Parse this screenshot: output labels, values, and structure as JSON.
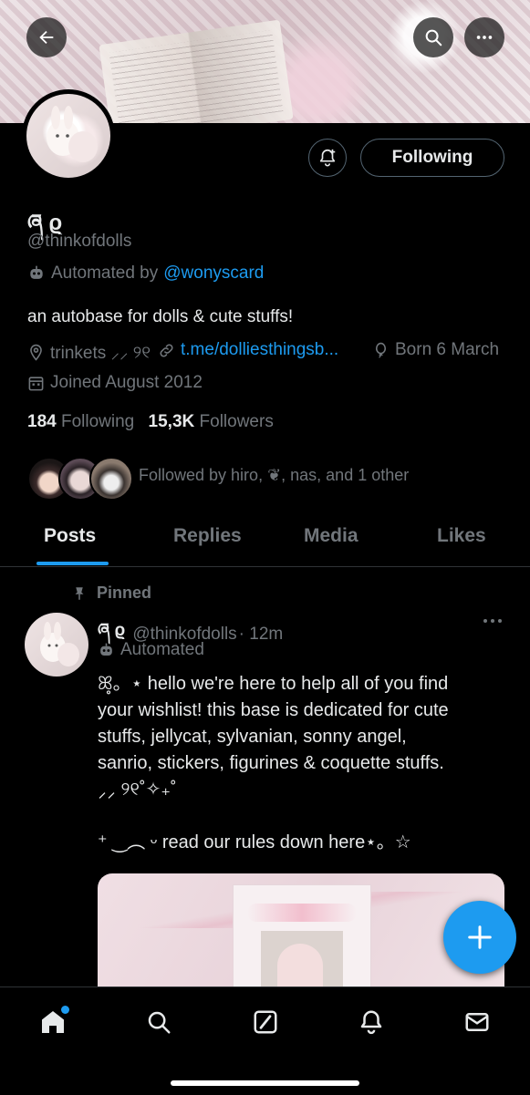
{
  "header": {
    "back_icon": "arrow-left-icon",
    "search_icon": "search-icon",
    "more_icon": "more-horizontal-icon"
  },
  "profile": {
    "display_name": "ཞ ϱ",
    "handle": "@thinkofdolls",
    "automated_prefix": "Automated by",
    "automated_by": "@wonyscard",
    "bio": "an autobase for dolls & cute stuffs!",
    "location": "trinkets ⸝⸝ ୨୧",
    "link": "t.me/dolliesthingsb...",
    "birthday": "Born 6 March",
    "joined": "Joined August 2012",
    "following_count": "184",
    "following_label": "Following",
    "followers_count": "15,3K",
    "followers_label": "Followers",
    "followed_by": "Followed by hiro, ❦, nas, and 1 other"
  },
  "actions": {
    "following_button": "Following",
    "notify_icon": "bell-plus-icon"
  },
  "tabs": [
    {
      "label": "Posts",
      "active": true
    },
    {
      "label": "Replies",
      "active": false
    },
    {
      "label": "Media",
      "active": false
    },
    {
      "label": "Likes",
      "active": false
    }
  ],
  "pinned_post": {
    "pinned_label": "Pinned",
    "author_name": "ཞ ϱ",
    "handle": "@thinkofdolls",
    "time": "· 12m",
    "automated_label": "Automated",
    "text_line1": "ꕤ̥͏。⋆ hello we're here to help all of you find",
    "text_line2": "your wishlist! this base is dedicated for cute",
    "text_line3": "stuffs, jellycat, sylvanian, sonny angel,",
    "text_line4": "sanrio, stickers, figurines & coquette stuffs.",
    "text_line5": "⸝⸝ ୨୧˚✧₊˚",
    "text_line6": "⁺ ‿︵ ᵕ read our rules down here⋆。☆",
    "more_icon": "more-horizontal-icon"
  },
  "fab": {
    "icon": "plus-icon"
  },
  "bottom_nav": [
    {
      "name": "home-icon",
      "active": true
    },
    {
      "name": "search-icon",
      "active": false
    },
    {
      "name": "grok-icon",
      "active": false
    },
    {
      "name": "notifications-icon",
      "active": false
    },
    {
      "name": "messages-icon",
      "active": false
    }
  ],
  "colors": {
    "accent": "#1d9bf0",
    "text_primary": "#e7e9ea",
    "text_secondary": "#71767b",
    "background": "#000000"
  }
}
